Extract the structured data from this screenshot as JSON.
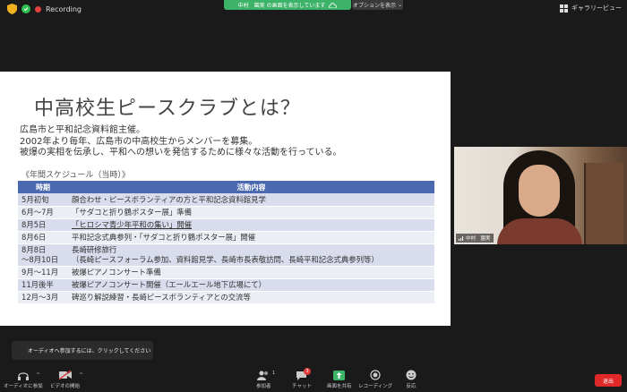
{
  "topbar": {
    "recording_label": "Recording",
    "share_banner": "中村　園実 の画面を表示しています",
    "view_options": "オプションを表示",
    "gallery_view": "ギャラリービュー"
  },
  "slide": {
    "title": "中高校生ピースクラブとは？",
    "intro_lines": [
      "広島市と平和記念資料館主催。",
      "2002年より毎年、広島市の中高校生からメンバーを募集。",
      "被爆の実相を伝承し、平和への想いを発信するために様々な活動を行っている。"
    ],
    "schedule_label": "《年間スケジュール（当時）》",
    "table_headers": [
      "時期",
      "活動内容"
    ],
    "rows": [
      {
        "period": "5月初旬",
        "activity": "顔合わせ・ピースボランティアの方と平和記念資料館見学"
      },
      {
        "period": "6月～7月",
        "activity": "「サダコと折り鶴ポスター展」準備"
      },
      {
        "period": "8月5日",
        "activity": "「ヒロシマ青少年平和の集い」開催"
      },
      {
        "period": "8月6日",
        "activity": "平和記念式典参列・「サダコと折り鶴ポスター展」開催"
      },
      {
        "period": "8月8日\n～8月10日",
        "activity": "長崎研修旅行\n（長崎ピースフォーラム参加、資料館見学、長崎市長表敬訪問、長崎平和記念式典参列等）"
      },
      {
        "period": "9月～11月",
        "activity": "被爆ピアノコンサート準備"
      },
      {
        "period": "11月後半",
        "activity": "被爆ピアノコンサート開催（エールエール地下広場にて）"
      },
      {
        "period": "12月～3月",
        "activity": "碑巡り解説練習・長崎ピースボランティアとの交流等"
      }
    ]
  },
  "video": {
    "participant_name": "中村　園実"
  },
  "audio_tooltip": "オーディオへ参加するには、クリックしてください",
  "toolbar": {
    "audio": "オーディオに参加",
    "video": "ビデオの開始",
    "participants": "参加者",
    "participants_count": "1",
    "chat": "チャット",
    "chat_badge": "3",
    "share": "画面を共有",
    "record": "レコーディング",
    "reactions": "反応",
    "leave": "退出"
  },
  "colors": {
    "accent_green": "#3db36a",
    "table_header": "#4b69b0",
    "leave_red": "#e02828"
  }
}
